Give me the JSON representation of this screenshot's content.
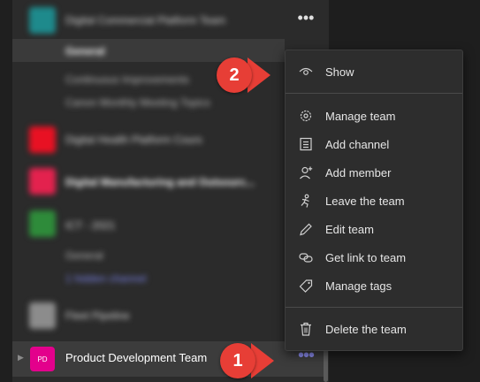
{
  "teams_list": {
    "blurred": [
      {
        "name": "Digital Commercial Platform Team",
        "color": "#1e8a8c"
      },
      {
        "name": "General",
        "kind": "channel-selected"
      },
      {
        "name": "Continuous Improvements",
        "kind": "channel"
      },
      {
        "name": "Canon Monthly Meeting Topics",
        "kind": "channel"
      },
      {
        "name": "Digital Health Platform Cours",
        "color": "#e81123"
      },
      {
        "name": "Digital Manufacturing and Outsourc...",
        "color": "#e3224e"
      },
      {
        "name": "ICT - 2021",
        "color": "#2e8b3a"
      },
      {
        "name": "General",
        "kind": "channel"
      },
      {
        "name": "1 hidden channel",
        "kind": "link"
      },
      {
        "name": "Fleet Pipeline",
        "color": "#8c8c8c"
      }
    ],
    "product_team": {
      "initials": "PD",
      "name": "Product Development Team",
      "avatar_color": "#e3008c",
      "more_glyph": "•••"
    },
    "top_more_glyph": "•••"
  },
  "context_menu": {
    "items": [
      {
        "label": "Show",
        "icon": "eye-icon"
      },
      {
        "label": "Manage team",
        "icon": "gear-icon"
      },
      {
        "label": "Add channel",
        "icon": "channel-icon"
      },
      {
        "label": "Add member",
        "icon": "add-person-icon"
      },
      {
        "label": "Leave the team",
        "icon": "leave-icon"
      },
      {
        "label": "Edit team",
        "icon": "pencil-icon"
      },
      {
        "label": "Get link to team",
        "icon": "link-icon"
      },
      {
        "label": "Manage tags",
        "icon": "tag-icon"
      },
      {
        "label": "Delete the team",
        "icon": "trash-icon"
      }
    ]
  },
  "callouts": [
    {
      "number": "2"
    },
    {
      "number": "1"
    }
  ],
  "colors": {
    "accent": "#8b8cf0",
    "callout": "#e73e36",
    "avatar": "#e3008c"
  }
}
